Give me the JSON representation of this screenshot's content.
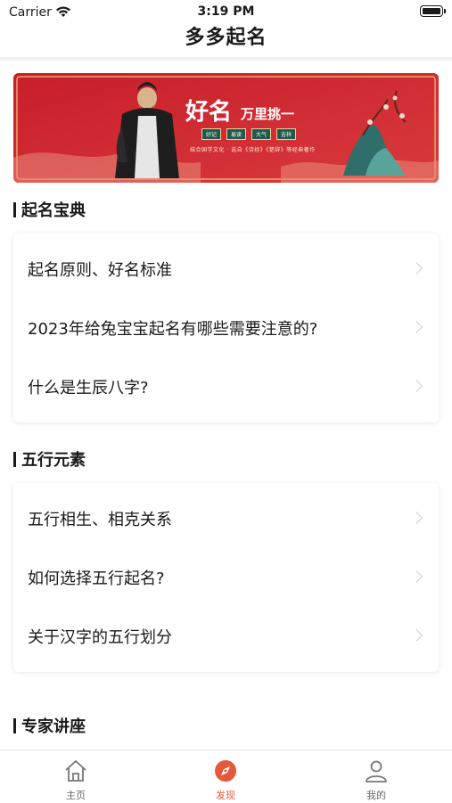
{
  "status": {
    "carrier": "Carrier",
    "time": "3:19 PM"
  },
  "header": {
    "title": "多多起名"
  },
  "banner": {
    "headline": "好名",
    "subheadline": "万里挑一",
    "tags": [
      "好记",
      "易读",
      "大气",
      "吉祥"
    ],
    "description": "结合国学文化 · 选自《诗经》《楚辞》等经典著作"
  },
  "sections": [
    {
      "title": "起名宝典",
      "items": [
        "起名原则、好名标准",
        "2023年给兔宝宝起名有哪些需要注意的?",
        "什么是生辰八字?"
      ]
    },
    {
      "title": "五行元素",
      "items": [
        "五行相生、相克关系",
        "如何选择五行起名?",
        "关于汉字的五行划分"
      ]
    },
    {
      "title": "专家讲座",
      "items": []
    }
  ],
  "tabbar": {
    "active": "发现",
    "items": [
      {
        "label": "主页",
        "icon": "home-icon"
      },
      {
        "label": "发现",
        "icon": "compass-icon"
      },
      {
        "label": "我的",
        "icon": "user-icon"
      }
    ],
    "active_color": "#e4593a"
  }
}
